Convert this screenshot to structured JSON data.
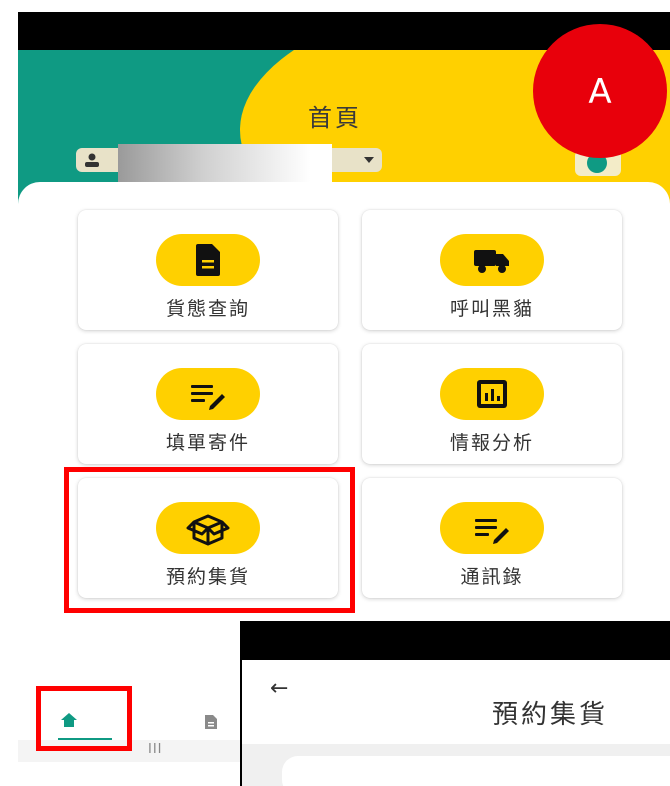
{
  "header": {
    "title": "首頁",
    "user_name": ""
  },
  "tiles": [
    {
      "label": "貨態查詢",
      "icon": "document-icon"
    },
    {
      "label": "呼叫黑貓",
      "icon": "truck-icon"
    },
    {
      "label": "填單寄件",
      "icon": "edit-list-icon"
    },
    {
      "label": "情報分析",
      "icon": "chart-icon"
    },
    {
      "label": "預約集貨",
      "icon": "box-icon"
    },
    {
      "label": "通訊錄",
      "icon": "edit-list-icon"
    }
  ],
  "bottom_nav": {
    "items": [
      "home-icon",
      "document-icon"
    ]
  },
  "system_nav": {
    "menu": "III"
  },
  "overlay_screen": {
    "back": "←",
    "title": "預約集貨"
  },
  "annotation": {
    "badge": "A"
  },
  "colors": {
    "accent_yellow": "#ffd000",
    "accent_teal": "#0f9a83",
    "highlight_red": "#ff0000",
    "badge_red": "#e8000b"
  }
}
